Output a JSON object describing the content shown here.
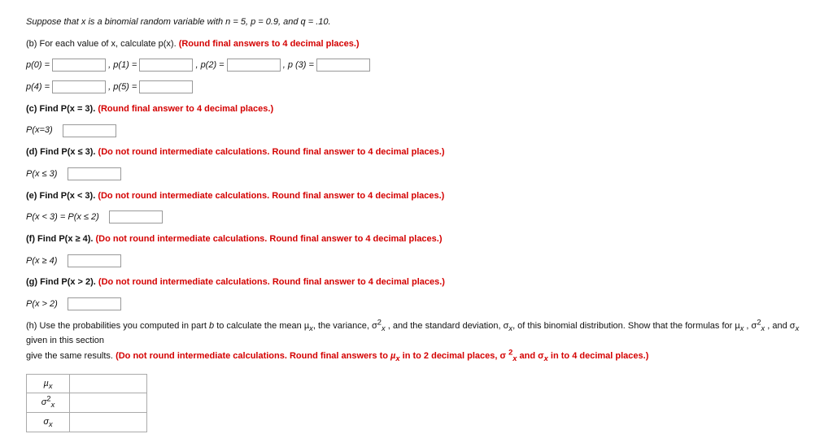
{
  "intro": "Suppose that x is a binomial random variable with n = 5, p = 0.9, and q = .10.",
  "partB": {
    "lead": "(b) For each value of x, calculate p(x). ",
    "hint": "(Round final answers to 4 decimal places.)",
    "p0": "p(0) = ",
    "p1": ", p(1) = ",
    "p2": ", p(2) = ",
    "p3": ", p (3) = ",
    "p4": "p(4) = ",
    "p5": ", p(5) = "
  },
  "partC": {
    "lead": "(c) Find P(x = 3). ",
    "hint": "(Round final answer to 4 decimal places.)",
    "ans": "P(x=3)"
  },
  "partD": {
    "lead": "(d) Find P(x ≤ 3). ",
    "hint": "(Do not round intermediate calculations. Round final answer to 4 decimal places.)",
    "ans": "P(x ≤ 3)"
  },
  "partE": {
    "lead": "(e) Find P(x < 3). ",
    "hint": "(Do not round intermediate calculations. Round final answer to 4 decimal places.)",
    "ans": "P(x < 3) = P(x ≤ 2)"
  },
  "partF": {
    "lead": "(f) Find P(x ≥ 4). ",
    "hint": "(Do not round intermediate calculations. Round final answer to 4 decimal places.)",
    "ans": "P(x ≥ 4)"
  },
  "partG": {
    "lead": "(g) Find P(x > 2). ",
    "hint": "(Do not round intermediate calculations. Round final answer to 4 decimal places.)",
    "ans": "P(x > 2)"
  },
  "partH": {
    "l1a": "(h) Use the probabilities you computed in part ",
    "l1i": "b",
    "l1b": " to calculate the mean µ",
    "l1c": ", the variance, σ",
    "l1d": " , and the standard deviation, σ",
    "l1e": ", of this binomial distribution. Show that the formulas for µ",
    "l1f": " , σ",
    "l1g": " , and σ",
    "l1h": " given in this section",
    "l2a": "give the same results. ",
    "l2b": "(Do not round intermediate calculations. Round final answers to ",
    "l2c": "µ",
    "l2d": " in to 2 decimal places, σ ",
    "l2e": " and σ",
    "l2f": " in to 4 decimal places.)"
  },
  "stats": {
    "mu": "µ",
    "var_a": "σ",
    "sd": "σ"
  },
  "sub_x": "x",
  "sub_x2": "x",
  "sup_2": "2"
}
